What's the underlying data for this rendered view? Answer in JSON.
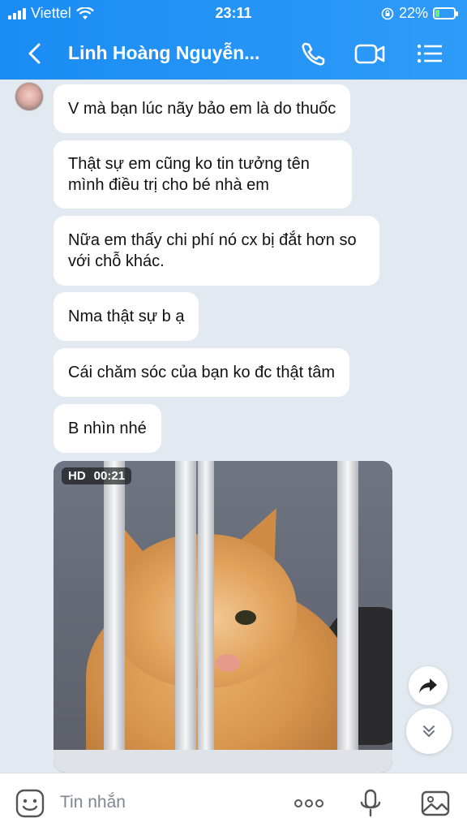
{
  "status_bar": {
    "carrier": "Viettel",
    "time": "23:11",
    "battery": "22%",
    "battery_level": 0.22
  },
  "header": {
    "title": "Linh Hoàng Nguyễn..."
  },
  "messages": [
    "V mà bạn lúc nãy bảo em là do thuốc",
    "Thật sự em cũng ko tin tưởng tên mình điều trị cho bé nhà em",
    "Nữa em thấy chi phí nó cx bị đắt hơn so với chỗ khác.",
    "Nma thật sự b ạ",
    "Cái chăm sóc của bạn ko đc thật tâm",
    "B nhìn nhé"
  ],
  "video": {
    "quality": "HD",
    "duration": "00:21"
  },
  "composer": {
    "placeholder": "Tin nhắn"
  },
  "colors": {
    "header": "#1a8cf4",
    "background": "#e2e9f1"
  }
}
